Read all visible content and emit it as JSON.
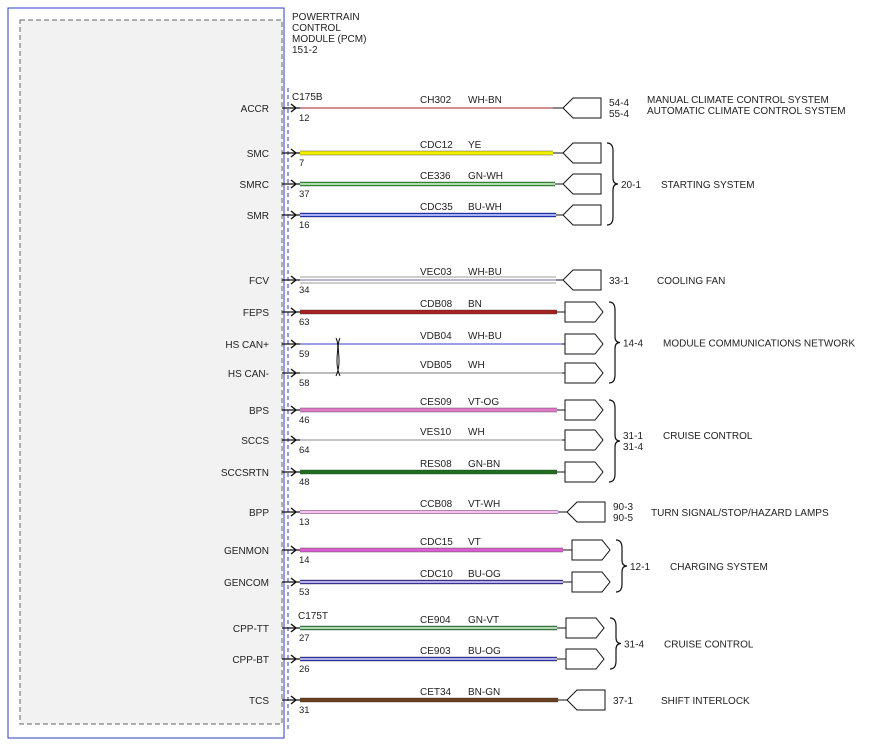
{
  "module": {
    "title_lines": [
      "POWERTRAIN",
      "CONTROL",
      "MODULE (PCM)",
      "151-2"
    ],
    "connectors": [
      "C175B",
      "C175T"
    ]
  },
  "colors": {
    "frame": "#2c3cc4",
    "dashed": "#666666",
    "bracket": "#111111"
  },
  "circuits": [
    {
      "pin_label": "ACCR",
      "pin": "12",
      "circuit": "CH302",
      "wire_color": "WH-BN",
      "stroke": "#b84a4a",
      "stripe": "#ffffff",
      "dest_refs": [
        "54-4",
        "55-4"
      ],
      "dest_labels": [
        "MANUAL CLIMATE CONTROL SYSTEM",
        "AUTOMATIC CLIMATE CONTROL SYSTEM"
      ],
      "arrow": "left"
    },
    {
      "pin_label": "SMC",
      "pin": "7",
      "circuit": "CDC12",
      "wire_color": "YE",
      "stroke": "#f2ee00",
      "stripe": "",
      "dest_refs": [],
      "dest_labels": [],
      "arrow": "left"
    },
    {
      "pin_label": "SMRC",
      "pin": "37",
      "circuit": "CE336",
      "wire_color": "GN-WH",
      "stroke": "#2e9b2e",
      "stripe": "#ffffff",
      "dest_refs": [],
      "dest_labels": [],
      "arrow": "left"
    },
    {
      "pin_label": "SMR",
      "pin": "16",
      "circuit": "CDC35",
      "wire_color": "BU-WH",
      "stroke": "#1a2fd4",
      "stripe": "#ffffff",
      "dest_refs": [],
      "dest_labels": [],
      "arrow": "left"
    },
    {
      "pin_label": "FCV",
      "pin": "34",
      "circuit": "VEC03",
      "wire_color": "WH-BU",
      "stroke": "#8c8cb8",
      "stripe": "#ffffff",
      "dest_refs": [
        "33-1"
      ],
      "dest_labels": [
        "COOLING FAN"
      ],
      "arrow": "left"
    },
    {
      "pin_label": "FEPS",
      "pin": "63",
      "circuit": "CDB08",
      "wire_color": "BN",
      "stroke": "#a82020",
      "stripe": "",
      "dest_refs": [],
      "dest_labels": [],
      "arrow": "right"
    },
    {
      "pin_label": "HS CAN+",
      "pin": "59",
      "circuit": "VDB04",
      "wire_color": "WH-BU",
      "stroke": "#3a3ad0",
      "stripe": "",
      "dest_refs": [],
      "dest_labels": [],
      "arrow": "right"
    },
    {
      "pin_label": "HS CAN-",
      "pin": "58",
      "circuit": "VDB05",
      "wire_color": "WH",
      "stroke": "#777777",
      "stripe": "",
      "dest_refs": [],
      "dest_labels": [],
      "arrow": "right"
    },
    {
      "pin_label": "BPS",
      "pin": "46",
      "circuit": "CES09",
      "wire_color": "VT-OG",
      "stroke": "#e07ac8",
      "stripe": "",
      "dest_refs": [],
      "dest_labels": [],
      "arrow": "right"
    },
    {
      "pin_label": "SCCS",
      "pin": "64",
      "circuit": "VES10",
      "wire_color": "WH",
      "stroke": "#888888",
      "stripe": "",
      "dest_refs": [],
      "dest_labels": [],
      "arrow": "right"
    },
    {
      "pin_label": "SCCSRTN",
      "pin": "48",
      "circuit": "RES08",
      "wire_color": "GN-BN",
      "stroke": "#1d6e1d",
      "stripe": "",
      "dest_refs": [],
      "dest_labels": [],
      "arrow": "right"
    },
    {
      "pin_label": "BPP",
      "pin": "13",
      "circuit": "CCB08",
      "wire_color": "VT-WH",
      "stroke": "#f080e0",
      "stripe": "#ffffff",
      "dest_refs": [
        "90-3",
        "90-5"
      ],
      "dest_labels": [
        "TURN SIGNAL/STOP/HAZARD LAMPS"
      ],
      "arrow": "left"
    },
    {
      "pin_label": "GENMON",
      "pin": "14",
      "circuit": "CDC15",
      "wire_color": "VT",
      "stroke": "#d95fd0",
      "stripe": "",
      "dest_refs": [],
      "dest_labels": [],
      "arrow": "right"
    },
    {
      "pin_label": "GENCOM",
      "pin": "53",
      "circuit": "CDC10",
      "wire_color": "BU-OG",
      "stroke": "#3a2fb0",
      "stripe": "#ffffff",
      "dest_refs": [],
      "dest_labels": [],
      "arrow": "right"
    },
    {
      "pin_label": "CPP-TT",
      "pin": "27",
      "circuit": "CE904",
      "wire_color": "GN-VT",
      "stroke": "#2f8f3a",
      "stripe": "#ffffff",
      "dest_refs": [],
      "dest_labels": [],
      "arrow": "right"
    },
    {
      "pin_label": "CPP-BT",
      "pin": "26",
      "circuit": "CE903",
      "wire_color": "BU-OG",
      "stroke": "#2a2fb8",
      "stripe": "#ffffff",
      "dest_refs": [],
      "dest_labels": [],
      "arrow": "right"
    },
    {
      "pin_label": "TCS",
      "pin": "31",
      "circuit": "CET34",
      "wire_color": "BN-GN",
      "stroke": "#6b3f1e",
      "stripe": "",
      "dest_refs": [
        "37-1"
      ],
      "dest_labels": [
        "SHIFT INTERLOCK"
      ],
      "arrow": "left"
    }
  ],
  "groups": [
    {
      "ref_lines": [
        "20-1"
      ],
      "label": "STARTING SYSTEM",
      "from": 1,
      "to": 3
    },
    {
      "ref_lines": [
        "14-4"
      ],
      "label": "MODULE COMMUNICATIONS NETWORK",
      "from": 5,
      "to": 7
    },
    {
      "ref_lines": [
        "31-1",
        "31-4"
      ],
      "label": "CRUISE CONTROL",
      "from": 8,
      "to": 10
    },
    {
      "ref_lines": [
        "12-1"
      ],
      "label": "CHARGING SYSTEM",
      "from": 12,
      "to": 13
    },
    {
      "ref_lines": [
        "31-4"
      ],
      "label": "CRUISE CONTROL",
      "from": 14,
      "to": 15
    }
  ]
}
